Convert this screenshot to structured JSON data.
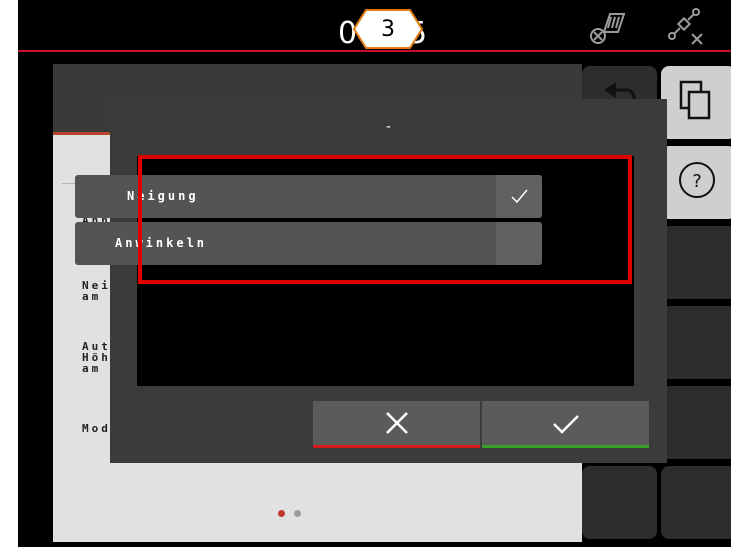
{
  "status_bar": {
    "time_left": "0",
    "time_right": "5",
    "callout_number": "3",
    "accent_color": "#c8102e",
    "icons": [
      "implement-icon",
      "gps-off-icon"
    ]
  },
  "background_screen": {
    "labels": [
      {
        "line1": "Anh",
        "line2": ""
      },
      {
        "line1": "Nei",
        "line2": "am"
      },
      {
        "line1": "Aut",
        "line2": "Höh",
        "line3": "am"
      },
      {
        "line1": "Mod",
        "line2": ""
      }
    ],
    "page_dots": 2,
    "active_page": 1
  },
  "sidebar": {
    "buttons": [
      "back-icon",
      "copy-icon",
      "help-icon",
      "",
      "",
      "",
      "",
      "",
      ""
    ]
  },
  "dialog": {
    "title": "-",
    "options": [
      {
        "label": "Neigung",
        "selected": true
      },
      {
        "label": "Anwinkeln",
        "selected": false
      }
    ],
    "cancel_icon": "cancel-x-icon",
    "confirm_icon": "confirm-check-icon",
    "cancel_color": "#d11a1a",
    "confirm_color": "#3aa02c",
    "highlight_color": "#e00000"
  }
}
